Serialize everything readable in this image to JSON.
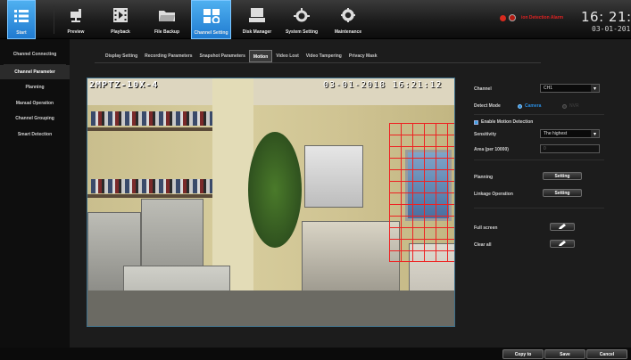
{
  "toolbar": {
    "items": [
      {
        "label": "Start",
        "icon": "list-icon",
        "active": true
      },
      {
        "label": "Preview",
        "icon": "camera-icon",
        "active": false
      },
      {
        "label": "Playback",
        "icon": "film-icon",
        "active": false
      },
      {
        "label": "File Backup",
        "icon": "folder-icon",
        "active": false
      },
      {
        "label": "Channel Setting",
        "icon": "channel-setting-icon",
        "active": true
      },
      {
        "label": "Disk Manager",
        "icon": "disk-icon",
        "active": false
      },
      {
        "label": "System Setting",
        "icon": "system-gear-icon",
        "active": false
      },
      {
        "label": "Maintenance",
        "icon": "gear-icon",
        "active": false
      }
    ],
    "alarm_text": "ion Detection Alarm",
    "clock_time": "16: 21: 1",
    "clock_date": "03-01-201"
  },
  "sidebar": {
    "items": [
      {
        "label": "Channel Connecting",
        "active": false
      },
      {
        "label": "Channel Parameter",
        "active": true
      },
      {
        "label": "Planning",
        "active": false
      },
      {
        "label": "Manual Operation",
        "active": false
      },
      {
        "label": "Channel Grouping",
        "active": false
      },
      {
        "label": "Smart Detection",
        "active": false
      }
    ]
  },
  "tabs": [
    {
      "label": "Display Setting",
      "active": false
    },
    {
      "label": "Recording Parameters",
      "active": false
    },
    {
      "label": "Snapshot Parameters",
      "active": false
    },
    {
      "label": "Motion",
      "active": true
    },
    {
      "label": "Video Lost",
      "active": false
    },
    {
      "label": "Video Tampering",
      "active": false
    },
    {
      "label": "Privacy Mask",
      "active": false
    }
  ],
  "camera": {
    "name": "2MPTZ-10X-4",
    "timestamp": "03-01-2018 16:21:12"
  },
  "settings": {
    "channel_label": "Channel",
    "channel_value": "CH1",
    "detect_mode_label": "Detect Mode",
    "detect_mode_options": [
      "Camera",
      "NVR"
    ],
    "detect_mode_selected": "Camera",
    "enable_label": "Enable Motion Detection",
    "sensitivity_label": "Sensitivity",
    "sensitivity_value": "The highest",
    "area_label": "Area (per 10000)",
    "area_value": "0",
    "planning_label": "Planning",
    "planning_button": "Setting",
    "linkage_label": "Linkage Operation",
    "linkage_button": "Setting",
    "full_screen_label": "Full screen",
    "clear_all_label": "Clear all"
  },
  "footer": {
    "copy_to": "Copy to",
    "save": "Save",
    "cancel": "Cancel"
  },
  "colors": {
    "accent": "#2a8de0",
    "alarm": "#d72a1e",
    "grid": "#ee2222"
  }
}
